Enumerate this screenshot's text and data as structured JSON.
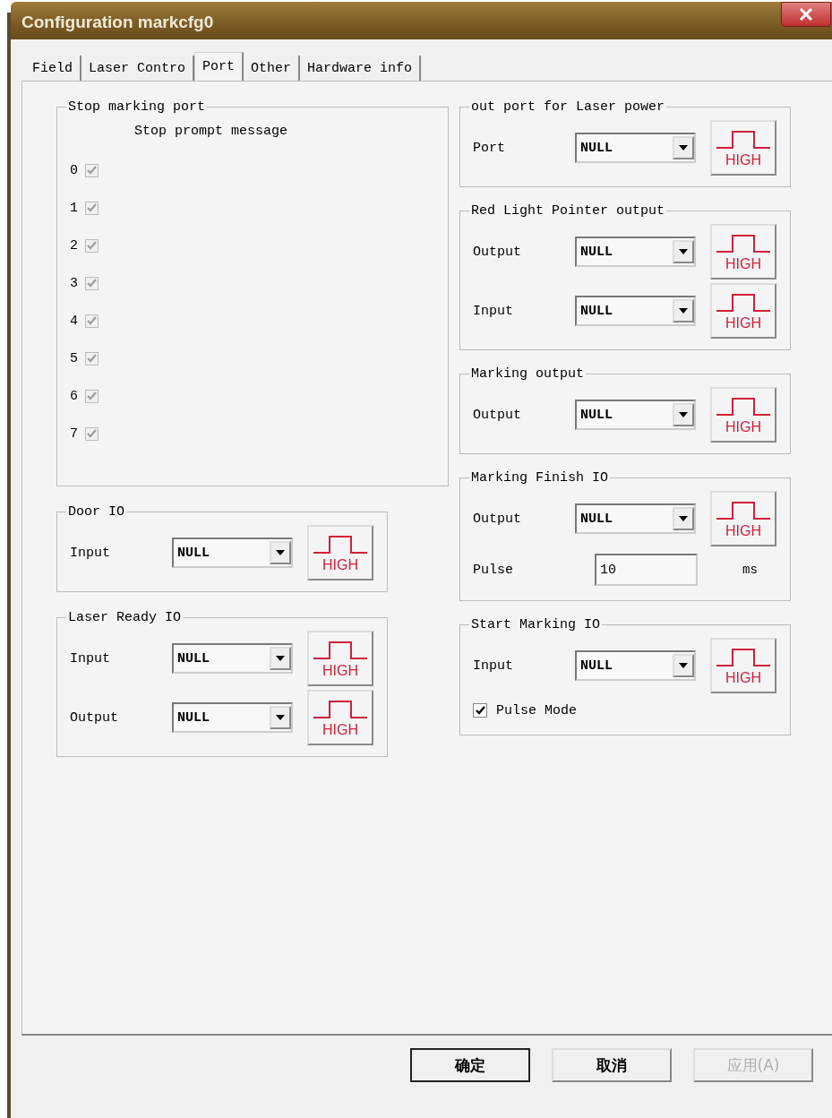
{
  "window": {
    "title": "Configuration markcfg0"
  },
  "tabs": [
    {
      "label": "Field",
      "selected": false
    },
    {
      "label": "Laser Contro",
      "selected": false
    },
    {
      "label": "Port",
      "selected": true
    },
    {
      "label": "Other",
      "selected": false
    },
    {
      "label": "Hardware info",
      "selected": false
    }
  ],
  "left_column": [
    {
      "kind": "checklist",
      "title": "Stop marking port",
      "caption": "Stop prompt message",
      "items": [
        {
          "label": "0",
          "checked": true,
          "disabled": true
        },
        {
          "label": "1",
          "checked": true,
          "disabled": true
        },
        {
          "label": "2",
          "checked": true,
          "disabled": true
        },
        {
          "label": "3",
          "checked": true,
          "disabled": true
        },
        {
          "label": "4",
          "checked": true,
          "disabled": true
        },
        {
          "label": "5",
          "checked": true,
          "disabled": true
        },
        {
          "label": "6",
          "checked": true,
          "disabled": true
        },
        {
          "label": "7",
          "checked": true,
          "disabled": true
        }
      ]
    },
    {
      "kind": "rows",
      "title": "Door IO",
      "rows": [
        {
          "kind": "select",
          "label": "Input",
          "value": "NULL",
          "level": "HIGH"
        }
      ]
    },
    {
      "kind": "rows",
      "title": "Laser Ready IO",
      "rows": [
        {
          "kind": "select",
          "label": "Input",
          "value": "NULL",
          "level": "HIGH"
        },
        {
          "kind": "select",
          "label": "Output",
          "value": "NULL",
          "level": "HIGH"
        }
      ]
    }
  ],
  "right_column": [
    {
      "kind": "rows",
      "title": "out port for Laser power",
      "rows": [
        {
          "kind": "select",
          "label": "Port",
          "value": "NULL",
          "level": "HIGH"
        }
      ]
    },
    {
      "kind": "rows",
      "title": "Red Light Pointer output",
      "rows": [
        {
          "kind": "select",
          "label": "Output",
          "value": "NULL",
          "level": "HIGH"
        },
        {
          "kind": "select",
          "label": "Input",
          "value": "NULL",
          "level": "HIGH"
        }
      ]
    },
    {
      "kind": "rows",
      "title": "Marking output",
      "rows": [
        {
          "kind": "select",
          "label": "Output",
          "value": "NULL",
          "level": "HIGH"
        }
      ]
    },
    {
      "kind": "rows",
      "title": "Marking Finish IO",
      "rows": [
        {
          "kind": "select",
          "label": "Output",
          "value": "NULL",
          "level": "HIGH"
        },
        {
          "kind": "text",
          "label": "Pulse",
          "value": "10",
          "unit": "ms"
        }
      ]
    },
    {
      "kind": "rows",
      "title": "Start Marking IO",
      "rows": [
        {
          "kind": "select",
          "label": "Input",
          "value": "NULL",
          "level": "HIGH"
        },
        {
          "kind": "checkbox",
          "label": "Pulse Mode",
          "checked": true
        }
      ]
    }
  ],
  "buttons": [
    {
      "label": "确定",
      "default": true,
      "disabled": false
    },
    {
      "label": "取消",
      "default": false,
      "disabled": false
    },
    {
      "label": "应用(A)",
      "default": false,
      "disabled": true
    }
  ]
}
